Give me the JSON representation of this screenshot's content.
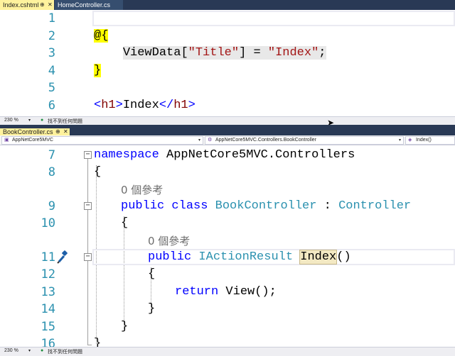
{
  "top_tabs": [
    {
      "label": "Index.cshtml",
      "active": true
    },
    {
      "label": "HomeController.cs",
      "active": false
    }
  ],
  "top_editor": {
    "lines": [
      {
        "num": "1"
      },
      {
        "num": "2",
        "text": "@{"
      },
      {
        "num": "3",
        "indent": "    ",
        "fn": "ViewData",
        "open": "[",
        "key": "\"Title\"",
        "close": "] = ",
        "val": "\"Index\"",
        "end": ";"
      },
      {
        "num": "4",
        "text": "}"
      },
      {
        "num": "5"
      },
      {
        "num": "6",
        "lt": "<",
        "tag": "h1",
        "gt": ">",
        "content": "Index",
        "lt2": "</",
        "tag2": "h1",
        "gt2": ">"
      }
    ]
  },
  "top_status": {
    "zoom": "230 %",
    "issues": "找不到任何問題"
  },
  "bottom_tabs": [
    {
      "label": "BookController.cs",
      "active": true
    }
  ],
  "navbar": {
    "project": "AppNetCore5MVC",
    "type": "AppNetCore5MVC.Controllers.BookController",
    "member": "Index()"
  },
  "bottom_editor": {
    "line7": {
      "num": "7",
      "kw": "namespace",
      "rest": " AppNetCore5MVC.Controllers"
    },
    "line8": {
      "num": "8",
      "text": "{"
    },
    "ref1": "0 個參考",
    "line9": {
      "num": "9",
      "kw1": "public",
      "kw2": "class",
      "name": "BookController",
      "colon": " : ",
      "base": "Controller"
    },
    "line10": {
      "num": "10",
      "text": "{"
    },
    "ref2": "0 個參考",
    "line11": {
      "num": "11",
      "kw": "public",
      "type": "IActionResult",
      "method": "Index",
      "paren": "()"
    },
    "line12": {
      "num": "12",
      "text": "{"
    },
    "line13": {
      "num": "13",
      "kw": "return",
      "rest": " View();"
    },
    "line14": {
      "num": "14",
      "text": "}"
    },
    "line15": {
      "num": "15",
      "text": "}"
    },
    "line16": {
      "num": "16",
      "text": "}"
    }
  },
  "bottom_status": {
    "zoom": "230 %",
    "issues": "找不到任何問題"
  },
  "icons": {
    "pin": "pin-icon",
    "close": "close-icon",
    "issues": "check-circle-icon",
    "quick_action": "screwdriver-icon",
    "cursor": "mouse-cursor-icon"
  },
  "colors": {
    "tab_strip": "#293955",
    "active_tab": "#fff29d",
    "keyword": "#0000ff",
    "type": "#2b91af",
    "string": "#a31515",
    "line_number": "#2b91af"
  }
}
